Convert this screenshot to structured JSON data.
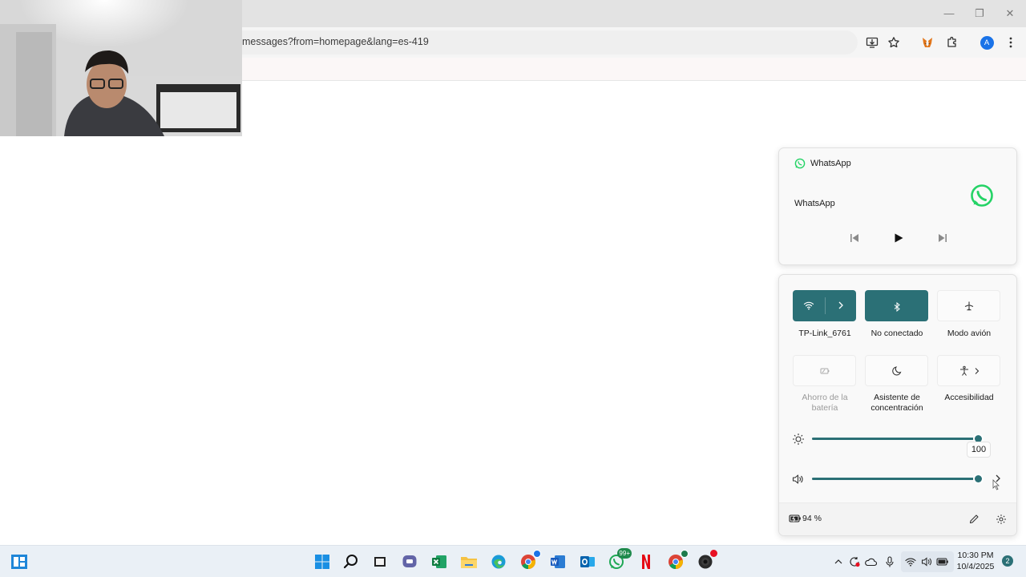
{
  "browser": {
    "url": "messages?from=homepage&lang=es-419",
    "avatar_letter": "A",
    "window_controls": {
      "minimize": "—",
      "restore": "❐",
      "close": "✕"
    }
  },
  "media": {
    "app_name": "WhatsApp",
    "track_title": "WhatsApp"
  },
  "quick_settings": {
    "tiles": [
      {
        "label": "TP-Link_6761",
        "state": "on"
      },
      {
        "label": "No conectado",
        "state": "on"
      },
      {
        "label": "Modo avión",
        "state": "off"
      },
      {
        "label_line1": "Ahorro de la",
        "label_line2": "batería",
        "state": "disabled"
      },
      {
        "label_line1": "Asistente de",
        "label_line2": "concentración",
        "state": "off"
      },
      {
        "label": "Accesibilidad",
        "state": "off"
      }
    ],
    "brightness": {
      "value": 100,
      "tooltip": "100"
    },
    "volume": {
      "value": 100
    },
    "battery_text": "94 %"
  },
  "taskbar": {
    "whatsapp_badge": "99+",
    "clock_time": "10:30 PM",
    "clock_date": "10/4/2025",
    "notification_count": "2"
  },
  "colors": {
    "accent": "#2b7076",
    "whatsapp_green": "#25d366"
  }
}
